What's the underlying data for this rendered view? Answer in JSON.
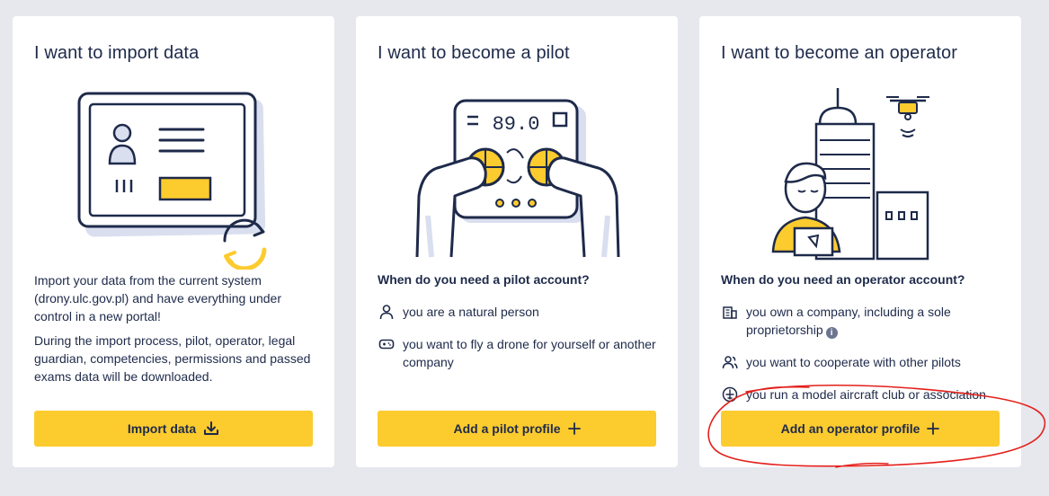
{
  "cards": [
    {
      "title": "I want to import data",
      "paragraphs": [
        "Import your data from the current system (drony.ulc.gov.pl) and have everything under control in a new portal!",
        "During the import process, pilot, operator, legal guardian, competencies, permissions and passed exams data will be downloaded."
      ],
      "button": {
        "label": "Import data",
        "icon": "download-icon"
      }
    },
    {
      "title": "I want to become a pilot",
      "question": "When do you need a pilot account?",
      "bullets": [
        {
          "icon": "person-icon",
          "text": "you are a natural person"
        },
        {
          "icon": "gamepad-icon",
          "text": "you want to fly a drone for yourself or another company"
        }
      ],
      "button": {
        "label": "Add a pilot profile",
        "icon": "plus-icon"
      }
    },
    {
      "title": "I want to become an operator",
      "question": "When do you need an operator account?",
      "bullets": [
        {
          "icon": "building-icon",
          "text": "you own a company, including a sole proprietorship"
        },
        {
          "icon": "users-icon",
          "text": "you want to cooperate with other pilots"
        },
        {
          "icon": "aircraft-club-icon",
          "text": "you run a model aircraft club or association"
        }
      ],
      "button": {
        "label": "Add an operator profile",
        "icon": "plus-icon"
      }
    }
  ],
  "illustrations": {
    "controller_display": "89.0"
  },
  "colors": {
    "background": "#e6e8ee",
    "card": "#ffffff",
    "accent_yellow": "#fccb2e",
    "ink_navy": "#1e2a4a",
    "annotation_red": "#e3201b"
  }
}
